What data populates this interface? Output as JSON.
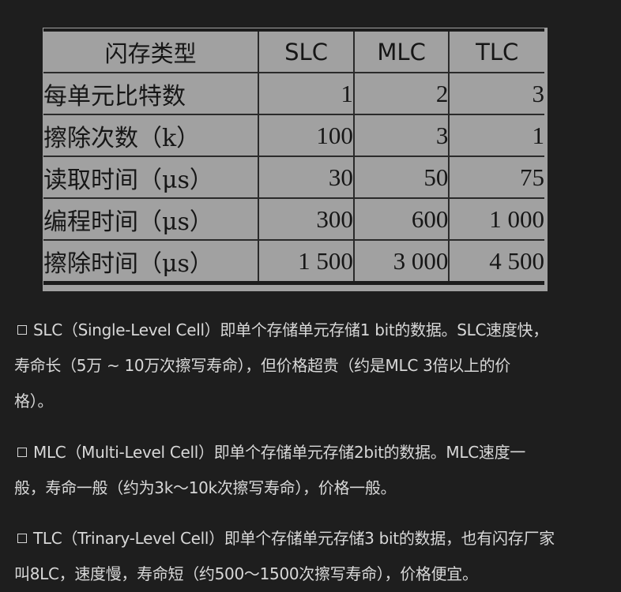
{
  "table": {
    "headers": [
      "闪存类型",
      "SLC",
      "MLC",
      "TLC"
    ],
    "rows": [
      {
        "label": "每单元比特数",
        "values": [
          "1",
          "2",
          "3"
        ]
      },
      {
        "label": "擦除次数（k）",
        "values": [
          "100",
          "3",
          "1"
        ]
      },
      {
        "label": "读取时间（μs）",
        "values": [
          "30",
          "50",
          "75"
        ]
      },
      {
        "label": "编程时间（μs）",
        "values": [
          "300",
          "600",
          "1 000"
        ]
      },
      {
        "label": "擦除时间（μs）",
        "values": [
          "1 500",
          "3 000",
          "4 500"
        ]
      }
    ]
  },
  "paragraphs": [
    {
      "line1": "SLC（Single-Level Cell）即单个存储单元存储1 bit的数据。SLC速度快，",
      "line2": "寿命长（5万 ~ 10万次擦写寿命），但价格超贵（约是MLC 3倍以上的价",
      "line3": "格）。"
    },
    {
      "line1": "MLC（Multi-Level Cell）即单个存储单元存储2bit的数据。MLC速度一",
      "line2": "般，寿命一般（约为3k～10k次擦写寿命），价格一般。"
    },
    {
      "line1": "TLC（Trinary-Level Cell）即单个存储单元存储3 bit的数据，也有闪存厂家",
      "line2": "叫8LC，速度慢，寿命短（约500～1500次擦写寿命），价格便宜。"
    }
  ]
}
